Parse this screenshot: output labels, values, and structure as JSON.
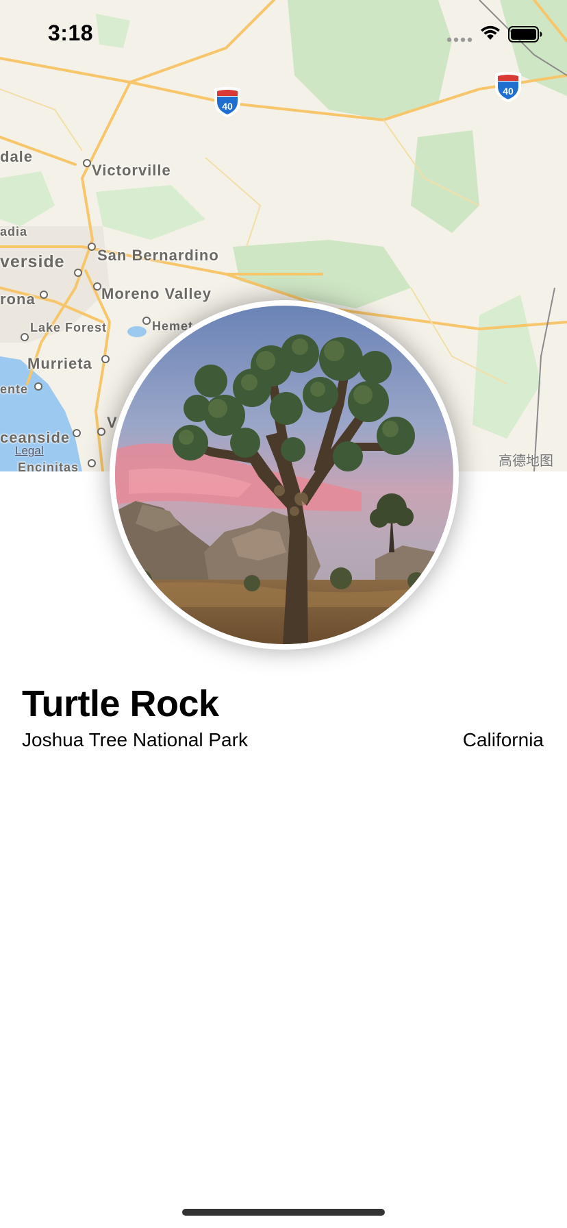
{
  "status_bar": {
    "time": "3:18"
  },
  "map": {
    "cities": [
      {
        "key": "dale",
        "label": "dale"
      },
      {
        "key": "victorville",
        "label": "Victorville"
      },
      {
        "key": "adia",
        "label": "adia"
      },
      {
        "key": "riverside",
        "label": "verside"
      },
      {
        "key": "san_bernardino",
        "label": "San Bernardino"
      },
      {
        "key": "corona",
        "label": "rona"
      },
      {
        "key": "moreno_valley",
        "label": "Moreno Valley"
      },
      {
        "key": "lake_forest",
        "label": "Lake Forest"
      },
      {
        "key": "hemet",
        "label": "Hemet"
      },
      {
        "key": "murrieta",
        "label": "Murrieta"
      },
      {
        "key": "ente",
        "label": "ente"
      },
      {
        "key": "oceanside",
        "label": "ceanside"
      },
      {
        "key": "encinitas",
        "label": "Encinitas"
      },
      {
        "key": "v",
        "label": "V"
      }
    ],
    "highway_shield": "40",
    "legal": "Legal",
    "brand": "高德地图",
    "colors": {
      "land": "#f4f1e8",
      "park": "#cfe6c4",
      "water": "#9cc9f0",
      "road": "#f7c66b"
    }
  },
  "landmark": {
    "name": "Turtle Rock",
    "park": "Joshua Tree National Park",
    "state": "California"
  }
}
